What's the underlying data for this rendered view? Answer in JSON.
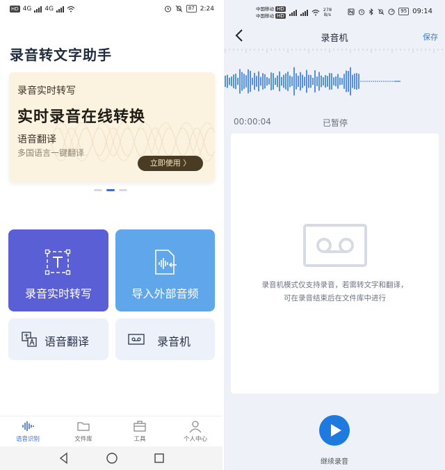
{
  "left": {
    "status_bar": {
      "badge": "HD",
      "net1": "4G",
      "net2": "4G",
      "battery": "87",
      "time": "2:24"
    },
    "app_title": "录音转文字助手",
    "banner": {
      "subtitle": "录音实时转写",
      "headline": "实时录音在线转换",
      "line3": "语音翻译",
      "line4": "多国语言一键翻译",
      "cta": "立即使用 〉",
      "bg_color": "#fbf2df"
    },
    "cards": {
      "realtime": {
        "label": "录音实时转写",
        "color": "#5b5fd6"
      },
      "import": {
        "label": "导入外部音频",
        "color": "#5fa6ea"
      },
      "translate": {
        "label": "语音翻译"
      },
      "recorder": {
        "label": "录音机"
      }
    },
    "tabs": [
      {
        "label": "语音识别",
        "icon": "waveform-icon",
        "active": true
      },
      {
        "label": "文件库",
        "icon": "folder-icon"
      },
      {
        "label": "工具",
        "icon": "toolbox-icon"
      },
      {
        "label": "个人中心",
        "icon": "person-icon"
      }
    ],
    "accent": "#3c6bd8"
  },
  "right": {
    "status_bar": {
      "carrier1": "中国移动",
      "carrier2": "中国移动",
      "badge": "HD",
      "speed_value": "278",
      "speed_unit": "B/s",
      "battery": "95",
      "time": "09:14"
    },
    "header": {
      "title": "录音机",
      "save": "保存"
    },
    "timer": "00:00:04",
    "state": "已暂停",
    "message_line1": "录音机模式仅支持录音，若需转文字和翻译，",
    "message_line2": "可在录音结束后在文件库中进行",
    "continue_label": "继续录音",
    "accent": "#1f7ae0"
  }
}
